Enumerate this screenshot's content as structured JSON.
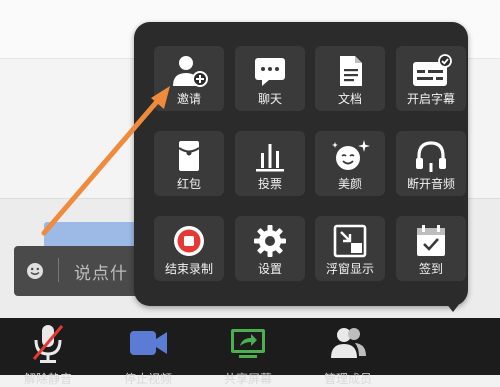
{
  "chat": {
    "placeholder": "说点什"
  },
  "menu": {
    "items": [
      {
        "label": "邀请",
        "icon": "invite-user-icon"
      },
      {
        "label": "聊天",
        "icon": "chat-bubble-icon"
      },
      {
        "label": "文档",
        "icon": "document-icon"
      },
      {
        "label": "开启字幕",
        "icon": "subtitles-icon"
      },
      {
        "label": "红包",
        "icon": "red-packet-icon"
      },
      {
        "label": "投票",
        "icon": "vote-chart-icon"
      },
      {
        "label": "美颜",
        "icon": "beauty-face-icon"
      },
      {
        "label": "断开音频",
        "icon": "headphones-icon"
      },
      {
        "label": "结束录制",
        "icon": "stop-record-icon"
      },
      {
        "label": "设置",
        "icon": "gear-icon"
      },
      {
        "label": "浮窗显示",
        "icon": "floating-window-icon"
      },
      {
        "label": "签到",
        "icon": "check-in-icon"
      }
    ]
  },
  "toolbar": {
    "items": [
      {
        "label": "解除静音",
        "icon": "mic-muted-icon"
      },
      {
        "label": "停止视频",
        "icon": "video-camera-icon"
      },
      {
        "label": "共享屏幕",
        "icon": "share-screen-icon"
      },
      {
        "label": "管理成员",
        "icon": "members-icon"
      }
    ]
  },
  "colors": {
    "accent_orange": "#f08a3c",
    "popup_bg": "#2b2b2b",
    "tile_bg": "#3a3a3a",
    "record_red": "#e53935",
    "video_blue": "#5b7bd5",
    "share_green": "#4caf50"
  }
}
